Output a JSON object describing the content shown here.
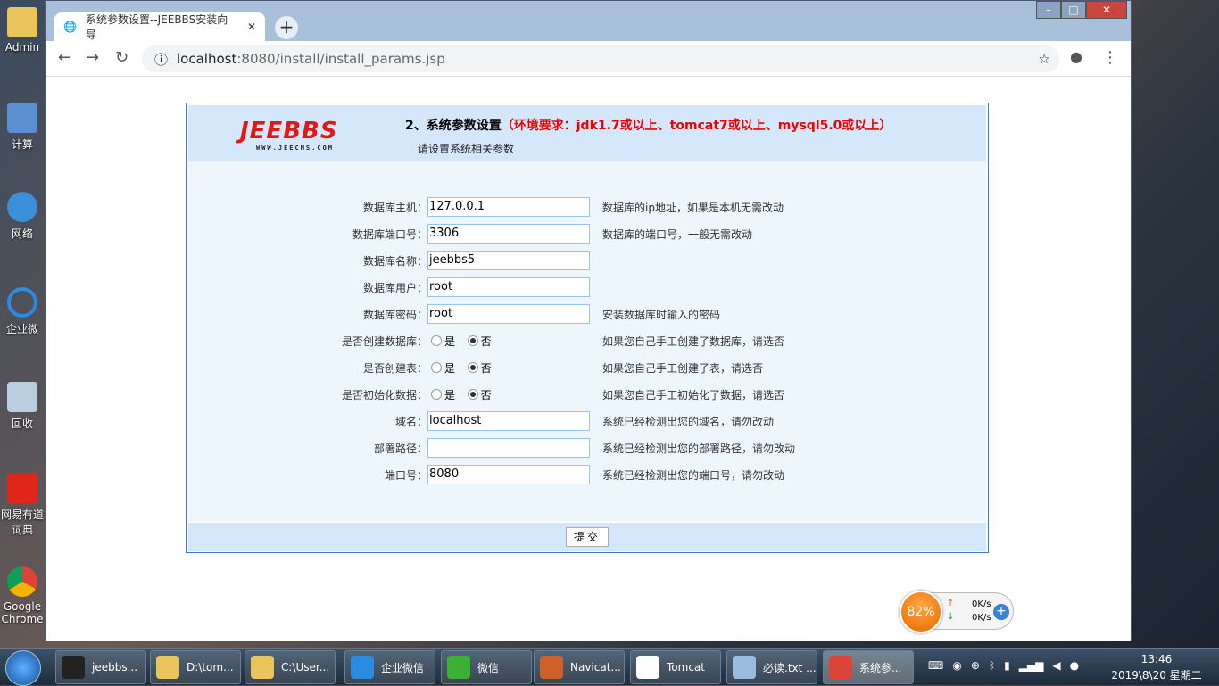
{
  "desktop": {
    "icons": [
      "Admin",
      "计算",
      "网络",
      "企业微",
      "回收",
      "网易有道词典",
      "Google Chrome"
    ]
  },
  "browser": {
    "tab_title": "系统参数设置--JEEBBS安装向导",
    "url_host": "localhost",
    "url_path": ":8080/install/install_params.jsp"
  },
  "page": {
    "logo_text": "JEEBBS",
    "logo_site": "WWW.JEECMS.COM",
    "title": "2、系统参数设置",
    "requirement": "（环境要求：jdk1.7或以上、tomcat7或以上、mysql5.0或以上）",
    "subtitle": "请设置系统相关参数",
    "fields": [
      {
        "label": "数据库主机：",
        "value": "127.0.0.1",
        "hint": "数据库的ip地址，如果是本机无需改动"
      },
      {
        "label": "数据库端口号：",
        "value": "3306",
        "hint": "数据库的端口号，一般无需改动"
      },
      {
        "label": "数据库名称：",
        "value": "jeebbs5",
        "hint": ""
      },
      {
        "label": "数据库用户：",
        "value": "root",
        "hint": ""
      },
      {
        "label": "数据库密码：",
        "value": "root",
        "hint": "安装数据库时输入的密码"
      }
    ],
    "radios": [
      {
        "label": "是否创建数据库：",
        "yes": "是",
        "no": "否",
        "selected": "no",
        "hint": "如果您自己手工创建了数据库，请选否"
      },
      {
        "label": "是否创建表：",
        "yes": "是",
        "no": "否",
        "selected": "no",
        "hint": "如果您自己手工创建了表，请选否"
      },
      {
        "label": "是否初始化数据：",
        "yes": "是",
        "no": "否",
        "selected": "no",
        "hint": "如果您自己手工初始化了数据，请选否"
      }
    ],
    "fields2": [
      {
        "label": "域名：",
        "value": "localhost",
        "hint": "系统已经检测出您的域名，请勿改动"
      },
      {
        "label": "部署路径：",
        "value": "",
        "hint": "系统已经检测出您的部署路径，请勿改动"
      },
      {
        "label": "端口号：",
        "value": "8080",
        "hint": "系统已经检测出您的端口号，请勿改动"
      }
    ],
    "submit": "提交"
  },
  "widget": {
    "percent": "82%",
    "up": "0K/s",
    "down": "0K/s"
  },
  "taskbar": {
    "items": [
      "jeebbs...",
      "D:\\tom...",
      "C:\\User...",
      "企业微信",
      "微信",
      "Navicat...",
      "Tomcat",
      "必读.txt ...",
      "系统参..."
    ],
    "time": "13:46",
    "date": "2019\\8\\20 星期二"
  }
}
